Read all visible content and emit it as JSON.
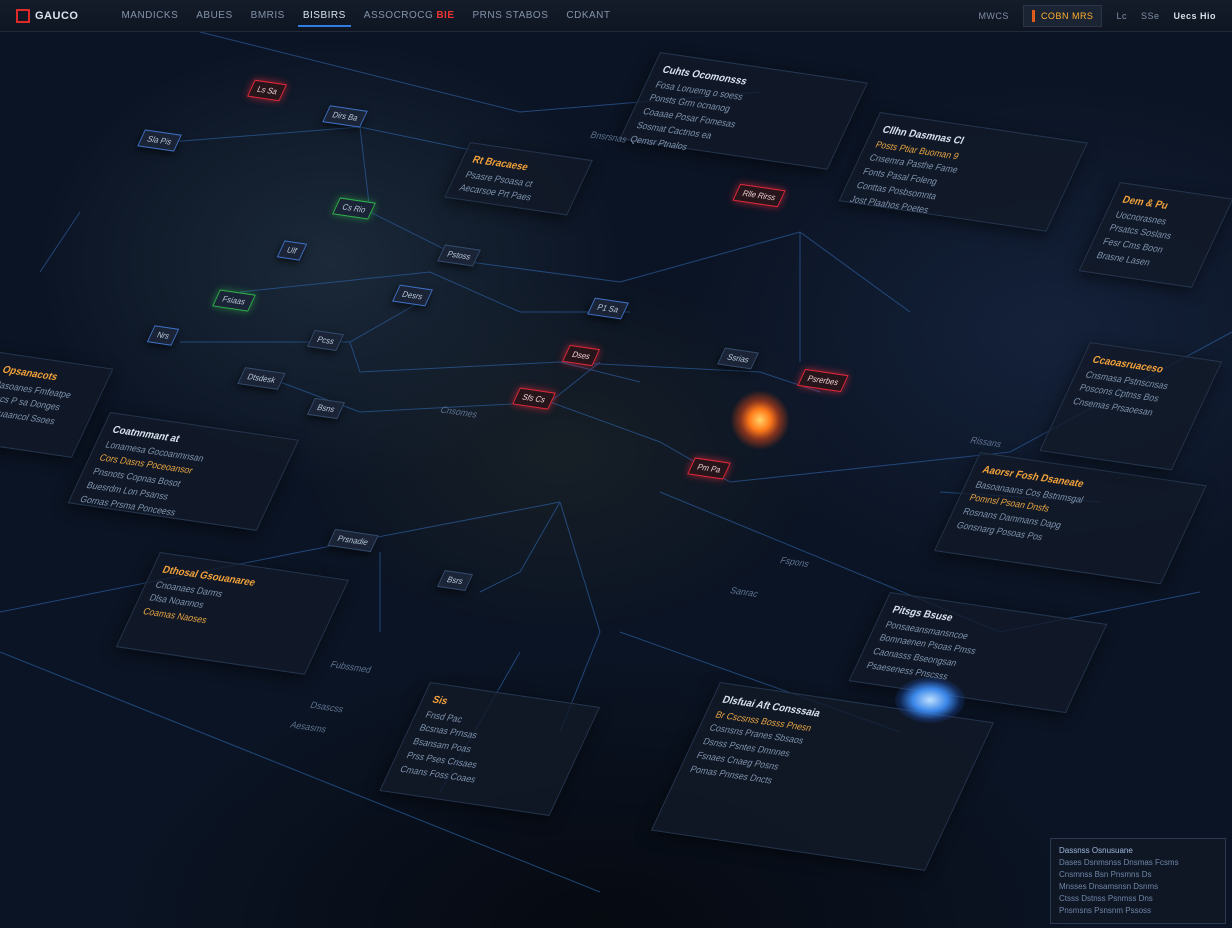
{
  "app": {
    "logo_text": "GAUCO"
  },
  "nav": {
    "items": [
      {
        "label": "MANDICKS"
      },
      {
        "label": "ABUES"
      },
      {
        "label": "BMRIS"
      },
      {
        "label": "BISBIRS",
        "active": true
      },
      {
        "label": "ASSOCROCG",
        "alert": "BIE"
      },
      {
        "label": "PRNS STABOS"
      },
      {
        "label": "CDKANT"
      }
    ]
  },
  "topright": {
    "status_label": "MWCS",
    "status_value": "COBN MRS",
    "item1": "Lc",
    "item2": "SSe",
    "user": "Uecs Hio"
  },
  "colors": {
    "accent": "#2f7de0",
    "alert": "#e0283a",
    "warning": "#f3a23a",
    "ok": "#2fae4a"
  },
  "cards": [
    {
      "title": "Cuhts Ocomonsss",
      "title_white": true,
      "lines": [
        "Fosa Loruemg o soess",
        "Ponsts Grm ocnanog",
        "Coaaae Posar Fomesas",
        "Sosmat Cactnos ea",
        "Qemsr Ptnalos"
      ]
    },
    {
      "title": "Cllhn Dasmnas Cl",
      "title_white": true,
      "lines": [
        "Posts Ptiar Buoman 9",
        "Cnsemra Pasthe Fame",
        "Fonts Pasal Foleng",
        "Conttas Posbsomnta",
        "Jost Plaahos Poetes"
      ]
    },
    {
      "title": "Dem & Pu",
      "lines": [
        "Uocnorasnes",
        "Prsatcs Soslans",
        "Fesr Cms Boon",
        "Brasne Lasen"
      ]
    },
    {
      "title": "Rt Bracaese",
      "lines": [
        "Psasre Psoasa ct",
        "Aecarsoe Prt Paes"
      ]
    },
    {
      "title": "Opsanacots",
      "lines": [
        "Jasoanes Fmfeatpe",
        "Pocs P sa Donges",
        "Ia Suaancol Ssoes"
      ]
    },
    {
      "title": "Coatnnmant at",
      "title_white": true,
      "lines": [
        "Lonamesa Gocoanmnsan",
        "Cors Dasns Poceoansor",
        "Pnsnots Copnas Bosot",
        "Buesrdm Lon Psanss",
        "Gornas Prsma Ponceess"
      ]
    },
    {
      "title": "Aaorsr Fosh Dsaneate",
      "lines": [
        "Basoanaans Cos Bstnmsgal",
        "Pomnsl Psoan Dnsfs",
        "Rosnans Dammans Dapg",
        "Gonsnarg Posoas Pos"
      ]
    },
    {
      "title": "Dthosal Gsouanaree",
      "lines": [
        "Cnoanaes Darms",
        "Dlsa Noannos",
        "Coamas Naoses"
      ]
    },
    {
      "title": "Sis",
      "lines": [
        "Fnsd Pac",
        "Bcsnas Prnsas",
        "Bsansam Poas",
        "Prss Pses Cnsaes",
        "Cmans Foss Coaes"
      ]
    },
    {
      "title": "Dlsfuai Aft Consssaia",
      "title_white": true,
      "lines": [
        "Br Cscsnss Bosss Pnesn",
        "Cosnsns Pranes Sbsaos",
        "Dsnss Psntes Dmnnes",
        "Fsnaes Cnaeg Posns",
        "Pomas Pnnses Dncts"
      ]
    },
    {
      "title": "Pitsgs Bsuse",
      "title_white": true,
      "lines": [
        "Ponsaeansmansncoe",
        "Bomnaenen Psoas Pmss",
        "Caonasss Bseongsan",
        "Psaeseness Pnscsss"
      ]
    },
    {
      "title": "Ccaoasruaceso",
      "lines": [
        "Cnsmasa Pstnscnsas",
        "Poscons Cptnss Bos",
        "Cnsemas Prsaoesan"
      ]
    }
  ],
  "nodes": [
    {
      "label": "Prsnadie"
    },
    {
      "label": "Bsrs"
    },
    {
      "label": "Ls Sa"
    },
    {
      "label": "Dirs Ba"
    },
    {
      "label": "Sla Pis"
    },
    {
      "label": "Rlle Rirss"
    },
    {
      "label": "Cs Rio"
    },
    {
      "label": "Ulf"
    },
    {
      "label": "Pstoss"
    },
    {
      "label": "Fsiaas"
    },
    {
      "label": "Desrs"
    },
    {
      "label": "P1 Sa"
    },
    {
      "label": "Nrs"
    },
    {
      "label": "Pcss"
    },
    {
      "label": "Dses"
    },
    {
      "label": "Ssrias"
    },
    {
      "label": "Psrerbes"
    },
    {
      "label": "Dtsdesk"
    },
    {
      "label": "Bsns"
    },
    {
      "label": "Sfs Cs"
    },
    {
      "label": "Pm Pa"
    }
  ],
  "floating_labels": [
    "Cnsomes",
    "Fspons",
    "Sanrac",
    "Fubssmed",
    "Aesasms",
    "Dsascss",
    "Rissans",
    "Bnsrsnas"
  ],
  "inset": {
    "title": "Dassnss Osnusuane",
    "lines": [
      "Dases Dsnmsnss Dnsmas Fcsms",
      "Cnsmnss Bsn Pnsmns Ds",
      "Mnsses Dnsamsnsn Dsnms",
      "Ctsss Dstnss Psnmss Dns",
      "Pnsmsns Psnsnm Pssoss"
    ]
  }
}
